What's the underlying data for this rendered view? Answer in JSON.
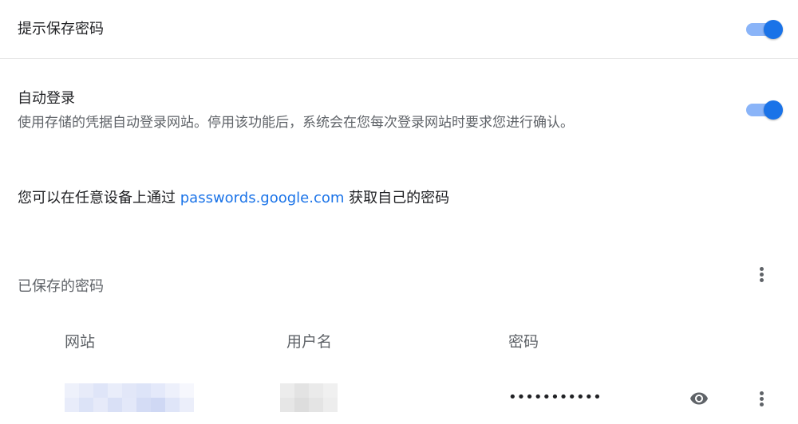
{
  "settings": {
    "offer_to_save": {
      "label": "提示保存密码",
      "enabled": true
    },
    "auto_signin": {
      "label": "自动登录",
      "description": "使用存储的凭据自动登录网站。停用该功能后，系统会在您每次登录网站时要求您进行确认。",
      "enabled": true
    }
  },
  "manage": {
    "prefix": "您可以在任意设备上通过 ",
    "link": "passwords.google.com",
    "suffix": " 获取自己的密码"
  },
  "saved_passwords": {
    "title": "已保存的密码",
    "columns": {
      "website": "网站",
      "username": "用户名",
      "password": "密码"
    },
    "rows": [
      {
        "website": "",
        "username": "",
        "password_masked": "•••••••••••"
      }
    ]
  },
  "colors": {
    "accent": "#1a73e8",
    "toggle_track": "#8ab4f8",
    "text_primary": "#202124",
    "text_secondary": "#5f6368",
    "divider": "#e6e6e6"
  },
  "icons": {
    "more": "more-vert-icon",
    "show_password": "eye-icon"
  }
}
